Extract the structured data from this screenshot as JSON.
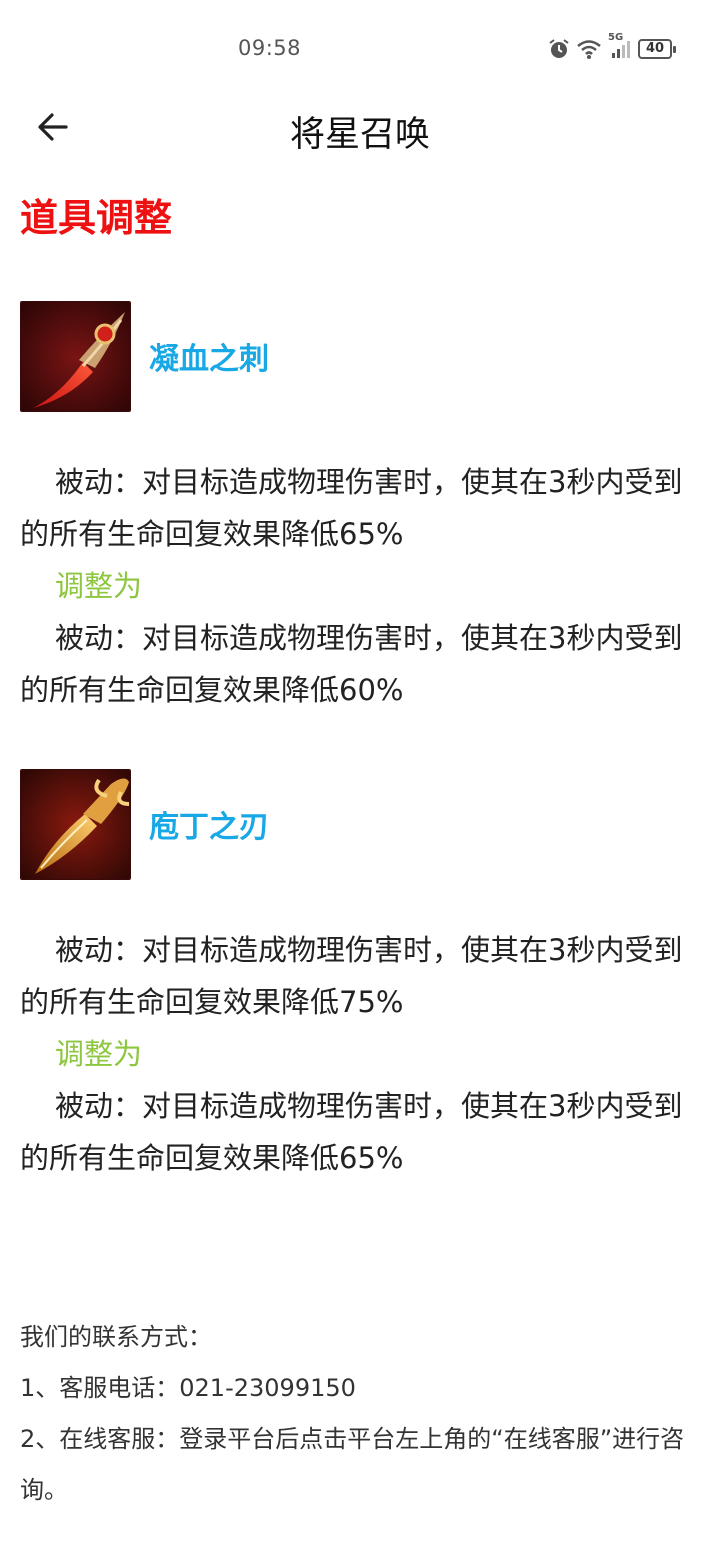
{
  "status_bar": {
    "time": "09:58",
    "network": "5G",
    "battery": "40",
    "icons": [
      "alarm-icon",
      "wifi-icon",
      "signal-icon",
      "battery-icon"
    ]
  },
  "nav": {
    "back_icon": "arrow-left-icon",
    "title": "将星召唤"
  },
  "section": {
    "title": "道具调整",
    "title_color": "#ee1111"
  },
  "items": [
    {
      "name": "凝血之刺",
      "icon": "blood-thorn-dagger-icon",
      "before": "被动：对目标造成物理伤害时，使其在3秒内受到的所有生命回复效果降低65%",
      "adjust_label": "调整为",
      "after": "被动：对目标造成物理伤害时，使其在3秒内受到的所有生命回复效果降低60%"
    },
    {
      "name": "庖丁之刃",
      "icon": "butcher-blade-icon",
      "before": "被动：对目标造成物理伤害时，使其在3秒内受到的所有生命回复效果降低75%",
      "adjust_label": "调整为",
      "after": "被动：对目标造成物理伤害时，使其在3秒内受到的所有生命回复效果降低65%"
    }
  ],
  "colors": {
    "item_name": "#18a8e6",
    "adjust_label": "#8dc63f"
  },
  "contact": {
    "heading": "我们的联系方式：",
    "line1": "1、客服电话：021-23099150",
    "line2": "2、在线客服：登录平台后点击平台左上角的“在线客服”进行咨询。"
  }
}
